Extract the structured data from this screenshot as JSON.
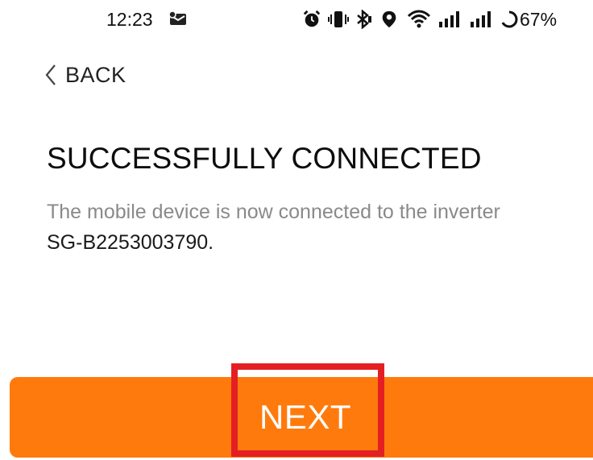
{
  "status_bar": {
    "time": "12:23",
    "battery": "67%",
    "icons": [
      "message-icon",
      "alarm-icon",
      "vibrate-icon",
      "bluetooth-icon",
      "location-icon",
      "wifi-icon",
      "signal-icon",
      "signal-icon-2",
      "battery-ring-icon"
    ]
  },
  "nav": {
    "back_label": "BACK"
  },
  "main": {
    "title": "SUCCESSFULLY CONNECTED",
    "description": "The mobile device is now connected to the inverter",
    "device_id": "SG-B2253003790."
  },
  "footer": {
    "next_label": "NEXT"
  },
  "colors": {
    "accent": "#ff7a0d",
    "highlight": "#e41f24",
    "muted_text": "#8a8a8a"
  }
}
